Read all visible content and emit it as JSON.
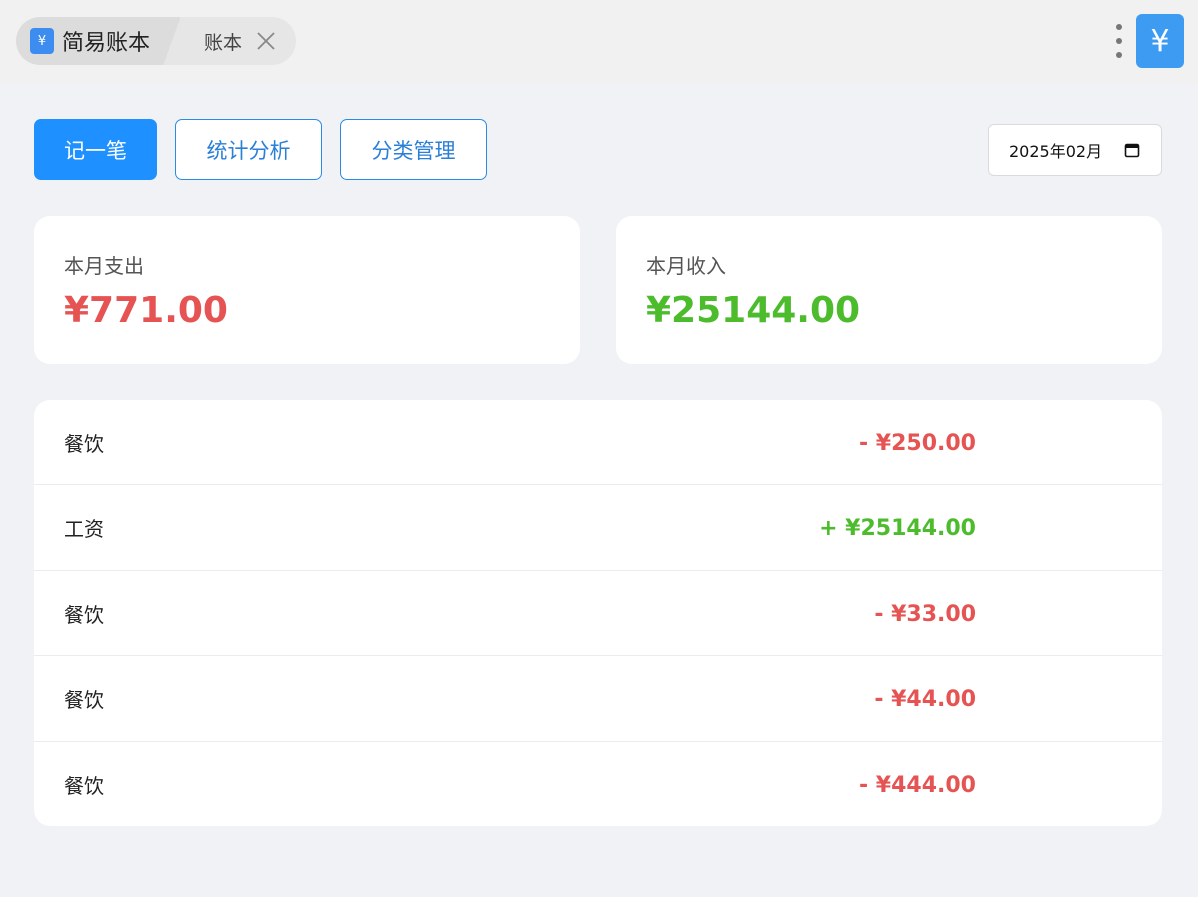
{
  "app": {
    "icon_glyph": "¥",
    "title": "简易账本",
    "tab_title": "账本",
    "corner_glyph": "¥"
  },
  "toolbar": {
    "record_label": "记一笔",
    "stats_label": "统计分析",
    "category_label": "分类管理",
    "month_value": "2025年02月"
  },
  "summary": {
    "expense_label": "本月支出",
    "expense_amount": "¥771.00",
    "income_label": "本月收入",
    "income_amount": "¥25144.00"
  },
  "transactions": [
    {
      "category": "餐饮",
      "amount": "- ¥250.00",
      "type": "expense"
    },
    {
      "category": "工资",
      "amount": "+ ¥25144.00",
      "type": "income"
    },
    {
      "category": "餐饮",
      "amount": "- ¥33.00",
      "type": "expense"
    },
    {
      "category": "餐饮",
      "amount": "- ¥44.00",
      "type": "expense"
    },
    {
      "category": "餐饮",
      "amount": "- ¥444.00",
      "type": "expense"
    }
  ],
  "colors": {
    "accent": "#1e90ff",
    "expense": "#e65353",
    "income": "#4cbb2c"
  }
}
